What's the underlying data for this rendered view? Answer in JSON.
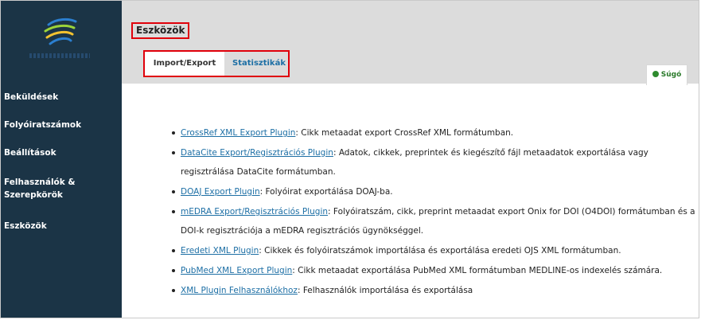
{
  "sidebar": {
    "items": [
      {
        "label": "Beküldések"
      },
      {
        "label": "Folyóiratszámok"
      },
      {
        "label": "Beállítások"
      },
      {
        "label": "Felhasználók &"
      },
      {
        "label": "Szerepkörök"
      },
      {
        "label": "Eszközök"
      }
    ]
  },
  "header": {
    "title": "Eszközök",
    "tabs": [
      {
        "label": "Import/Export",
        "active": true
      },
      {
        "label": "Statisztikák",
        "active": false
      }
    ],
    "help_label": "Súgó"
  },
  "plugins": [
    {
      "name": "CrossRef XML Export Plugin",
      "description": ": Cikk metaadat export CrossRef XML formátumban."
    },
    {
      "name": "DataCite Export/Regisztrációs Plugin",
      "description": ": Adatok, cikkek, preprintek és kiegészítő fájl metaadatok exportálása vagy regisztrálása DataCite formátumban."
    },
    {
      "name": "DOAJ Export Plugin",
      "description": ": Folyóirat exportálása DOAJ-ba."
    },
    {
      "name": "mEDRA Export/Regisztrációs Plugin",
      "description": ": Folyóiratszám, cikk, preprint metaadat export Onix for DOI (O4DOI) formátumban és a DOI-k regisztrációja a mEDRA regisztrációs ügynökséggel."
    },
    {
      "name": "Eredeti XML Plugin",
      "description": ": Cikkek és folyóiratszámok importálása és exportálása eredeti OJS XML formátumban."
    },
    {
      "name": "PubMed XML Export Plugin",
      "description": ": Cikk metaadat exportálása PubMed XML formátumban MEDLINE-os indexelés számára."
    },
    {
      "name": "XML Plugin Felhasználókhoz",
      "description": ": Felhasználók importálása és exportálása"
    }
  ],
  "colors": {
    "sidebar_bg": "#1b3446",
    "topbar_bg": "#dcdcdc",
    "link": "#1d6fa5",
    "highlight": "#e0000a",
    "help_green": "#2e8b2e"
  }
}
